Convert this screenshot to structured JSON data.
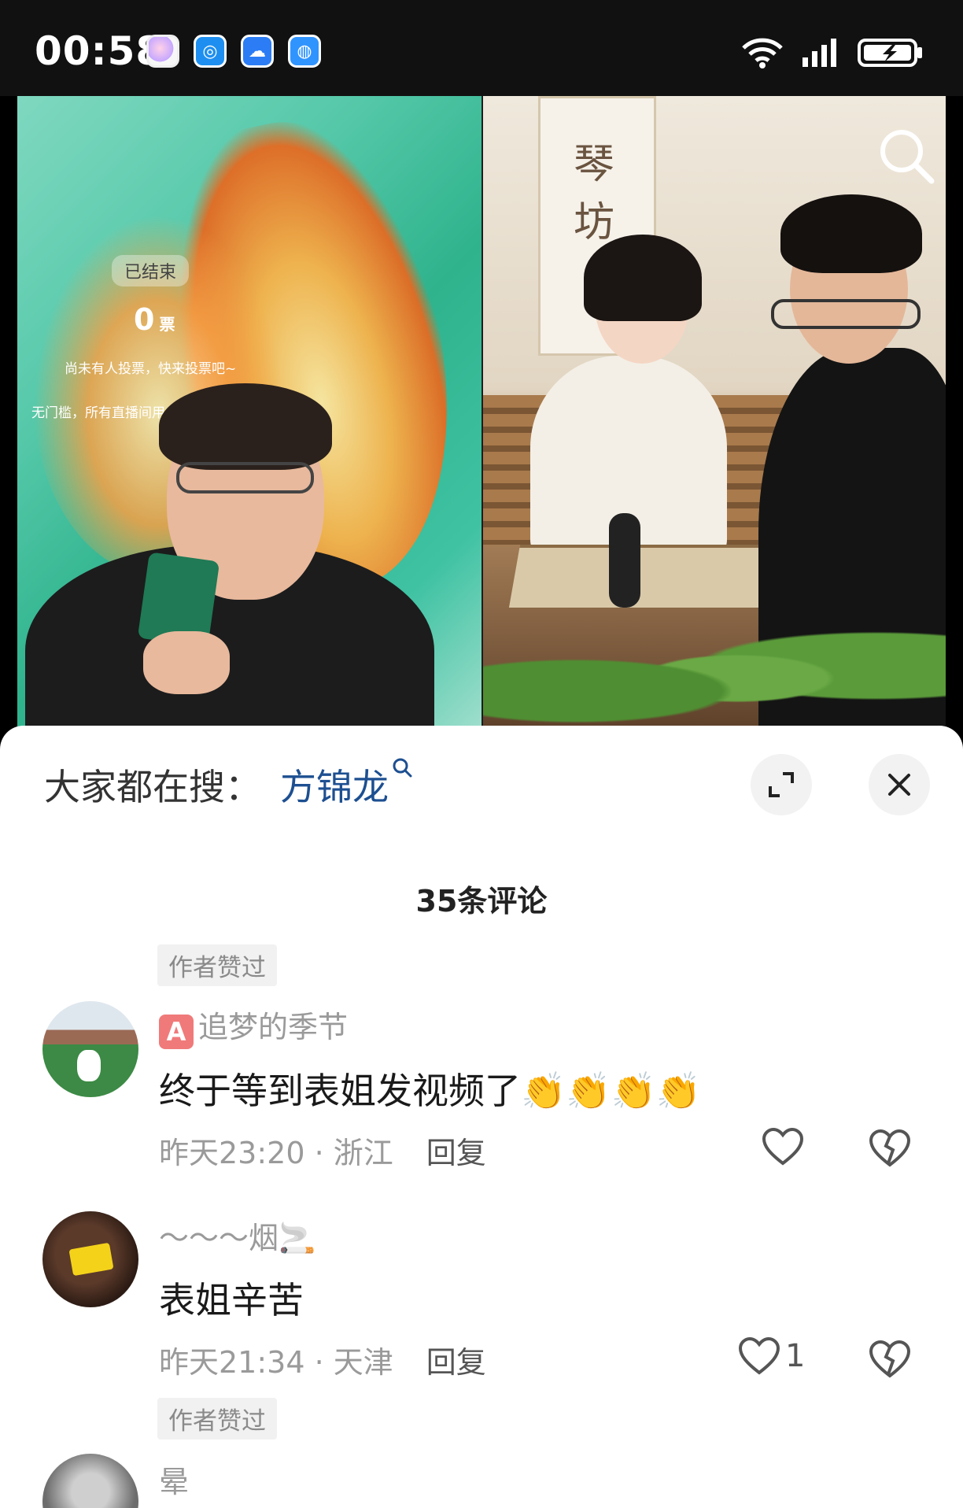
{
  "status_bar": {
    "time": "00:58",
    "app_icons": [
      "gallery-app-icon",
      "browser-app-icon",
      "weather-app-icon",
      "globe-app-icon"
    ],
    "indicators": [
      "wifi-icon",
      "signal-icon",
      "battery-charging-icon"
    ]
  },
  "video": {
    "left_panel": {
      "vote_status": "已结束",
      "vote_count": "0",
      "vote_unit": "票",
      "vote_hint": "尚未有人投票，快来投票吧~",
      "vote_rule": "无门槛，所有直播间用户均可投票，每位"
    },
    "right_panel": {
      "scroll_text": "琴坊"
    }
  },
  "sheet": {
    "hot_search_label": "大家都在搜：",
    "hot_search_keyword": "方锦龙",
    "comment_count": "35条评论",
    "comments": [
      {
        "author_liked_tag": "作者赞过",
        "badge": "A",
        "username": "追梦的季节",
        "text": "终于等到表姐发视频了👏👏👏👏",
        "time_location": "昨天23:20 · 浙江",
        "reply": "回复",
        "likes": ""
      },
      {
        "username": "～～～烟🚬",
        "text": "表姐辛苦",
        "time_location": "昨天21:34 · 天津",
        "reply": "回复",
        "likes": "1",
        "author_liked_tag": "作者赞过"
      },
      {
        "username": "晕"
      }
    ]
  },
  "colors": {
    "keyword": "#1d4f91",
    "muted_text": "#9a9a9a",
    "badge_a": "#f07a7a"
  }
}
